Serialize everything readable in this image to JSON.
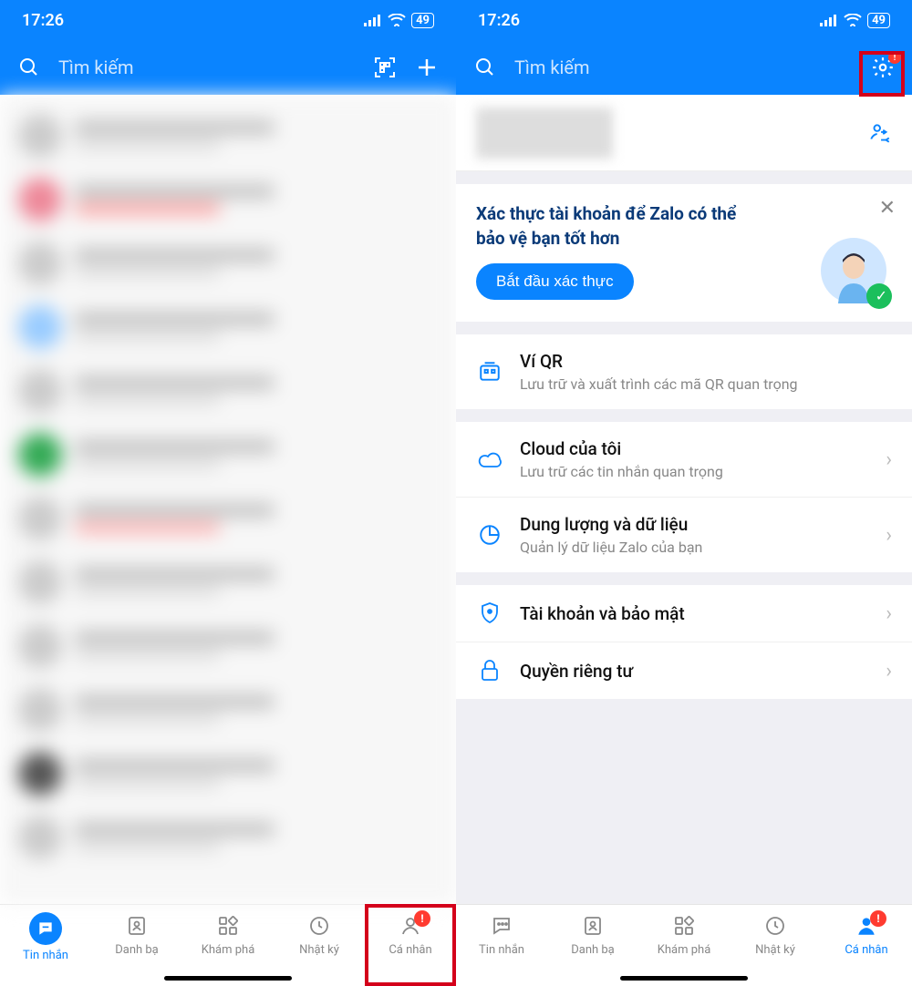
{
  "status": {
    "time": "17:26",
    "battery": "49"
  },
  "header": {
    "search_placeholder": "Tìm kiếm"
  },
  "verify": {
    "title": "Xác thực tài khoản để Zalo có thể bảo vệ bạn tốt hơn",
    "button": "Bắt đầu xác thực"
  },
  "menu": {
    "qr_wallet": {
      "title": "Ví QR",
      "sub": "Lưu trữ và xuất trình các mã QR quan trọng"
    },
    "cloud": {
      "title": "Cloud của tôi",
      "sub": "Lưu trữ các tin nhắn quan trọng"
    },
    "storage": {
      "title": "Dung lượng và dữ liệu",
      "sub": "Quản lý dữ liệu Zalo của bạn"
    },
    "account": {
      "title": "Tài khoản và bảo mật"
    },
    "privacy": {
      "title": "Quyền riêng tư"
    }
  },
  "tabs": {
    "messages": "Tin nhắn",
    "contacts": "Danh bạ",
    "discover": "Khám phá",
    "timeline": "Nhật ký",
    "me": "Cá nhân"
  }
}
